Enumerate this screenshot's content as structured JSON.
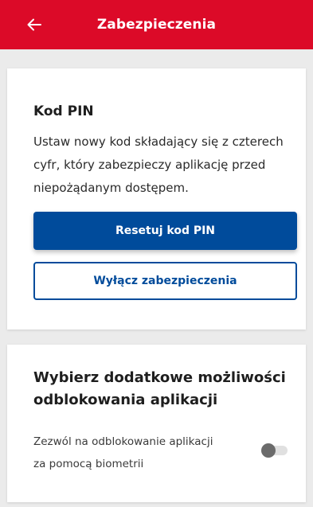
{
  "header": {
    "title": "Zabezpieczenia",
    "back_icon": "arrow-left-icon",
    "background_color": "#dc0a28"
  },
  "pin_section": {
    "title": "Kod PIN",
    "description_lines": [
      "Ustaw nowy kod składający się z czterech",
      "cyfr, który zabezpieczy aplikację przed",
      "niepożądanym dostępem."
    ],
    "reset_button_label": "Resetuj kod PIN",
    "disable_button_label": "Wyłącz zabezpieczenia",
    "accent_color": "#004b9b"
  },
  "unlock_section": {
    "title_lines": [
      "Wybierz dodatkowe możliwości",
      "odblokowania aplikacji"
    ],
    "biometric_label_lines": [
      "Zezwól na odblokowanie aplikacji",
      "za pomocą biometrii"
    ],
    "biometric_enabled": false
  }
}
